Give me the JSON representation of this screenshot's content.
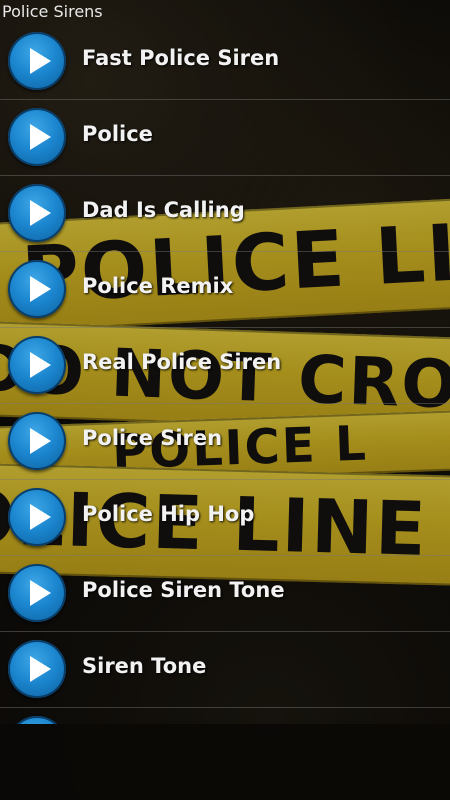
{
  "app": {
    "title": "Police Sirens"
  },
  "background": {
    "tape_texts": [
      "POLICE LI",
      "DO NOT CROS",
      "POLICE L",
      "POLICE LINE DO"
    ]
  },
  "list": {
    "items": [
      {
        "label": "Fast Police Siren"
      },
      {
        "label": "Police"
      },
      {
        "label": "Dad Is Calling"
      },
      {
        "label": "Police Remix"
      },
      {
        "label": "Real Police Siren"
      },
      {
        "label": "Police Siren"
      },
      {
        "label": "Police Hip Hop"
      },
      {
        "label": "Police Siren Tone"
      },
      {
        "label": "Siren Tone"
      }
    ]
  },
  "colors": {
    "play_button": "#1b86cf",
    "tape_yellow": "#d8c23a",
    "text": "#f2f2f2"
  },
  "icons": {
    "play": "play-icon"
  }
}
